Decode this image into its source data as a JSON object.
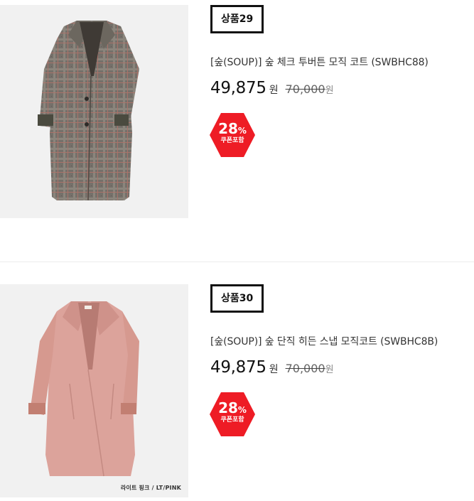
{
  "products": [
    {
      "badge": "상품29",
      "name": "[숲(SOUP)] 숲 체크 투버튼 모직 코트 (SWBHC88)",
      "price": "49,875",
      "currency": "원",
      "original_price": "70,000",
      "original_currency": "원",
      "discount_rate": "28",
      "discount_unit": "%",
      "discount_label": "쿠폰포함",
      "image_icon": "plaid-wool-coat-image",
      "image_color": "#7a746c"
    },
    {
      "badge": "상품30",
      "name": "[숲(SOUP)] 숲 단직 히든 스냅 모직코트 (SWBHC8B)",
      "price": "49,875",
      "currency": "원",
      "original_price": "70,000",
      "original_currency": "원",
      "discount_rate": "28",
      "discount_unit": "%",
      "discount_label": "쿠폰포함",
      "image_icon": "pink-wool-coat-image",
      "image_color": "#dca39b",
      "image_caption": "라이트 핑크 / LT/PINK"
    }
  ],
  "colors": {
    "discount_badge": "#ee1c25",
    "badge_border": "#111111",
    "divider": "#ececec"
  }
}
